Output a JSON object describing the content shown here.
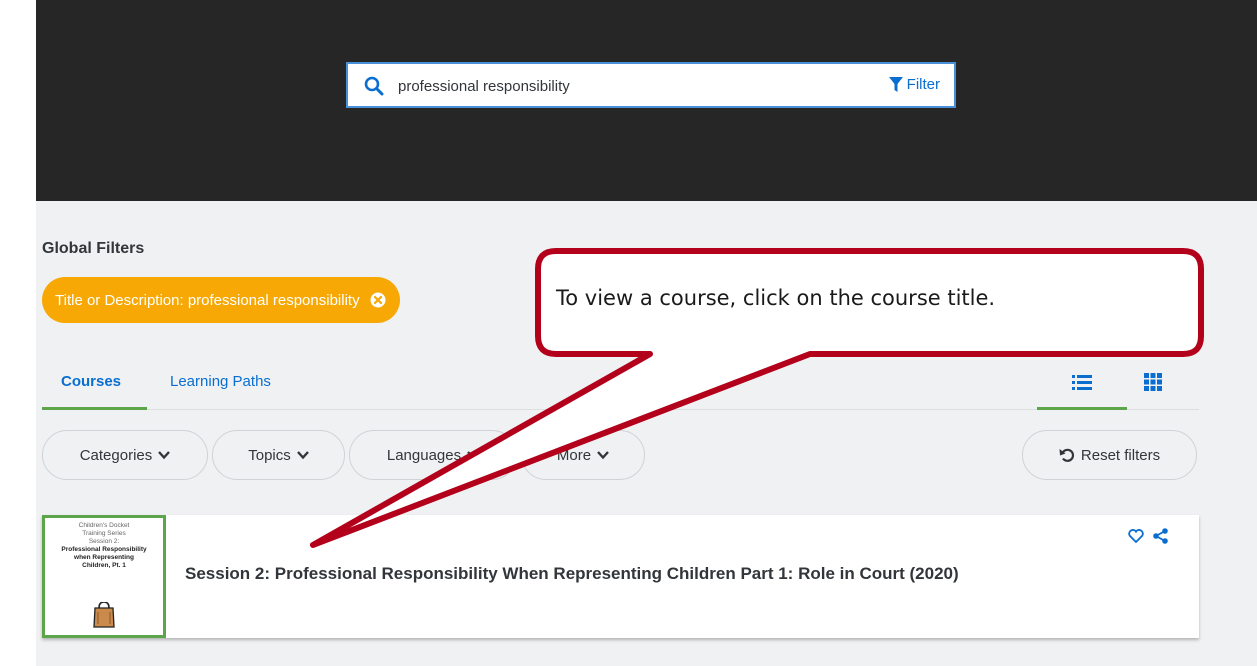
{
  "search": {
    "value": "professional responsibility",
    "filter_label": "Filter",
    "icon": "search-icon",
    "filter_icon": "funnel-icon"
  },
  "global_filters": {
    "title": "Global Filters",
    "chip_label": "Title or Description: professional responsibility",
    "chip_icon": "remove-circle-icon"
  },
  "tabs": [
    {
      "label": "Courses",
      "active": true
    },
    {
      "label": "Learning Paths",
      "active": false
    }
  ],
  "view_icons": [
    "list-view-icon",
    "grid-view-icon"
  ],
  "filter_buttons": [
    {
      "label": "Categories"
    },
    {
      "label": "Topics"
    },
    {
      "label": "Languages"
    },
    {
      "label": "More"
    }
  ],
  "reset_label": "Reset filters",
  "course": {
    "title": "Session 2: Professional Responsibility When Representing Children Part 1: Role in Court (2020)",
    "thumbnail": {
      "line1": "Children's Docket",
      "line2": "Training Series",
      "line3": "Session 2:",
      "line4": "Professional Responsibility",
      "line5": "when Representing",
      "line6": "Children, Pt. 1"
    }
  },
  "callout": {
    "text": "To view a course, click on the course title."
  },
  "colors": {
    "accent": "#0a6ed1",
    "chip": "#f7a805",
    "tab_underline": "#5da54b",
    "callout_border": "#b3001b"
  }
}
